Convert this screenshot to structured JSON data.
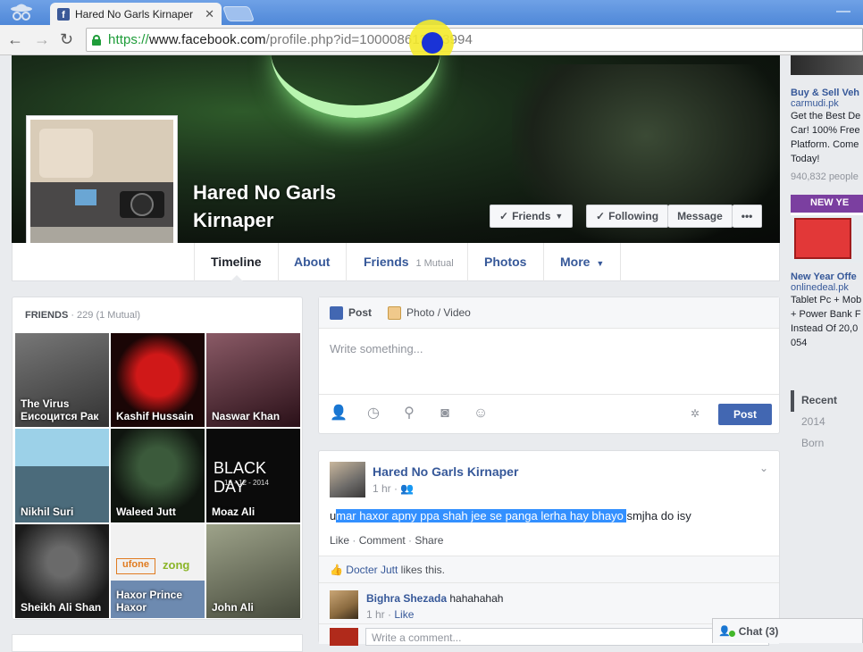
{
  "browser": {
    "tab_title": "Hared No Garls Kirnaper",
    "tab_favicon": "f",
    "url_proto": "https://",
    "url_host": "www.facebook.com",
    "url_path": "/profile.php?id=100008613793994"
  },
  "profile": {
    "name": "Hared No Garls Kirnaper",
    "buttons": {
      "friends": "Friends",
      "following": "Following",
      "message": "Message",
      "more": "•••"
    }
  },
  "nav": {
    "timeline": "Timeline",
    "about": "About",
    "friends": "Friends",
    "friends_mutual": "1 Mutual",
    "photos": "Photos",
    "more": "More"
  },
  "ads": {
    "ad1_title": "Buy & Sell Veh",
    "ad1_link": "carmudi.pk",
    "ad1_lines": [
      "Get the Best De",
      "Car! 100% Free",
      "Platform. Come",
      "Today!"
    ],
    "ad1_meta": "940,832 people",
    "ad2_banner": "NEW YE",
    "ad2_title": "New Year Offe",
    "ad2_link": "onlinedeal.pk",
    "ad2_lines": [
      "Tablet Pc + Mob",
      "+ Power Bank F",
      "Instead Of 20,0",
      "054"
    ]
  },
  "year_nav": [
    "Recent",
    "2014",
    "Born"
  ],
  "friends_box": {
    "label": "FRIENDS",
    "count": " · 229 (1 Mutual)",
    "friends": [
      {
        "name": "The Virus\nЕисоцится Рак",
        "color": "#555"
      },
      {
        "name": "Kashif Hussain",
        "color": "#3a1010"
      },
      {
        "name": "Naswar Khan",
        "color": "#552233"
      },
      {
        "name": "Nikhil Suri",
        "color": "#5a7e97"
      },
      {
        "name": "Waleed Jutt",
        "color": "#243424"
      },
      {
        "name": "Moaz Ali",
        "color": "#111"
      },
      {
        "name": "Sheikh Ali Shan",
        "color": "#3a3a3a"
      },
      {
        "name": "Haxor Prince\nHaxor",
        "color": "#dcdcdc"
      },
      {
        "name": "John Ali",
        "color": "#6a6e5a"
      }
    ],
    "tile_text_black_day": "BLACK DAY",
    "tile_text_black_date": "16 - 12 - 2014"
  },
  "composer": {
    "tab_post": "Post",
    "tab_photo": "Photo / Video",
    "placeholder": "Write something...",
    "post_button": "Post"
  },
  "story": {
    "author": "Hared No Garls Kirnaper",
    "time": "1 hr",
    "text_prefix": "u",
    "text_selected": "mar haxor apny ppa shah jee se panga lerha hay bhayo ",
    "text_suffix": "smjha do isy",
    "action_like": "Like",
    "action_comment": "Comment",
    "action_share": "Share",
    "likes_name": "Docter Jutt",
    "likes_text": " likes this.",
    "comment_name": "Bighra Shezada",
    "comment_text": " hahahahah",
    "comment_time": "1 hr",
    "comment_like": "Like",
    "write_comment": "Write a comment..."
  },
  "chat": {
    "label": "Chat (3)"
  }
}
